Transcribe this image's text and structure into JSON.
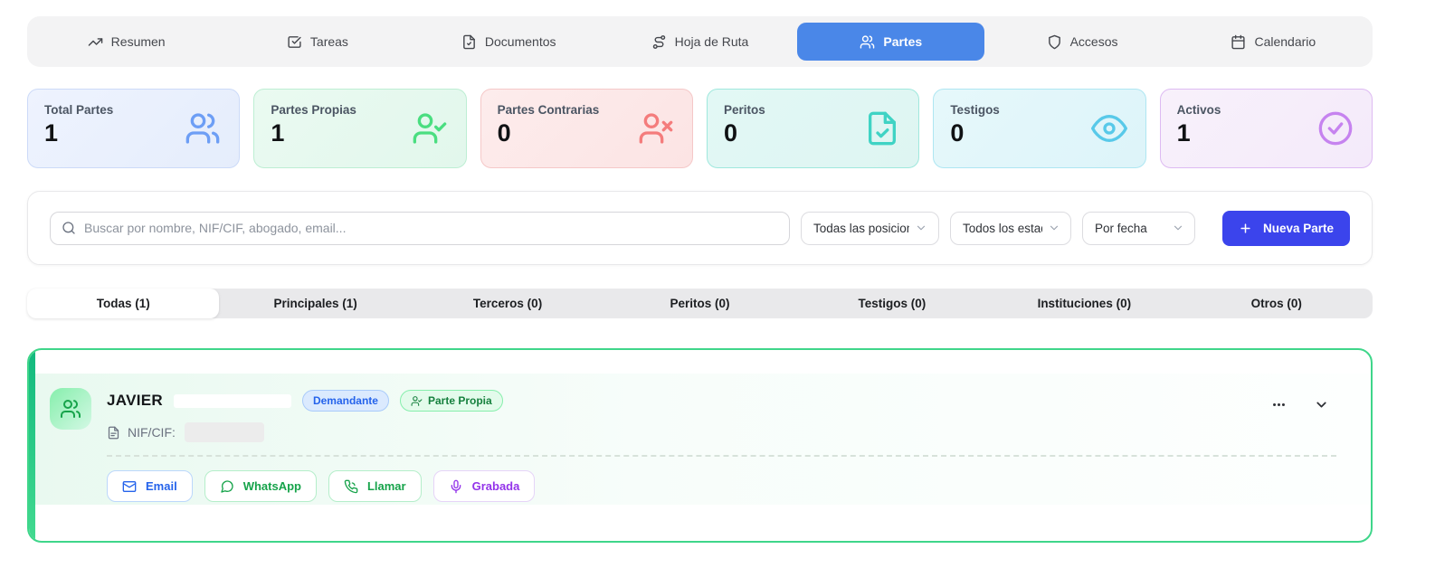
{
  "nav_tabs": {
    "active_color": "#4a87e8",
    "items": [
      {
        "label": "Resumen",
        "icon": "trending-up-icon",
        "active": false
      },
      {
        "label": "Tareas",
        "icon": "check-square-icon",
        "active": false
      },
      {
        "label": "Documentos",
        "icon": "file-text-icon",
        "active": false
      },
      {
        "label": "Hoja de Ruta",
        "icon": "route-icon",
        "active": false
      },
      {
        "label": "Partes",
        "icon": "users-icon",
        "active": true
      },
      {
        "label": "Accesos",
        "icon": "shield-icon",
        "active": false
      },
      {
        "label": "Calendario",
        "icon": "calendar-icon",
        "active": false
      }
    ]
  },
  "stats": {
    "cards": [
      {
        "label": "Total Partes",
        "value": "1",
        "icon": "users-icon",
        "accent": "#6d9ef5"
      },
      {
        "label": "Partes Propias",
        "value": "1",
        "icon": "user-check-icon",
        "accent": "#4ade80"
      },
      {
        "label": "Partes Contrarias",
        "value": "0",
        "icon": "user-x-icon",
        "accent": "#f47c7c"
      },
      {
        "label": "Peritos",
        "value": "0",
        "icon": "file-check-icon",
        "accent": "#3fd3c4"
      },
      {
        "label": "Testigos",
        "value": "0",
        "icon": "eye-icon",
        "accent": "#58c9e9"
      },
      {
        "label": "Activos",
        "value": "1",
        "icon": "check-circle-icon",
        "accent": "#c683ef"
      }
    ]
  },
  "toolbar": {
    "search_placeholder": "Buscar por nombre, NIF/CIF, abogado, email...",
    "position_filter": "Todas las posiciones",
    "status_filter": "Todos los estados",
    "date_filter": "Por fecha",
    "new_button_label": "Nueva Parte",
    "new_button_color": "#3b44ec"
  },
  "filter_tabs": {
    "items": [
      {
        "label": "Todas (1)",
        "active": true
      },
      {
        "label": "Principales (1)",
        "active": false
      },
      {
        "label": "Terceros (0)",
        "active": false
      },
      {
        "label": "Peritos (0)",
        "active": false
      },
      {
        "label": "Testigos (0)",
        "active": false
      },
      {
        "label": "Instituciones (0)",
        "active": false
      },
      {
        "label": "Otros (0)",
        "active": false
      }
    ]
  },
  "party_card": {
    "accent_color": "#3fd68a",
    "name": "JAVIER",
    "position_badge": "Demandante",
    "ownership_badge": "Parte Propia",
    "nif_label": "NIF/CIF:",
    "actions": [
      {
        "label": "Email",
        "icon": "mail-icon",
        "color": "#2563eb"
      },
      {
        "label": "WhatsApp",
        "icon": "message-circle-icon",
        "color": "#16a34a"
      },
      {
        "label": "Llamar",
        "icon": "phone-call-icon",
        "color": "#16a34a"
      },
      {
        "label": "Grabada",
        "icon": "mic-icon",
        "color": "#9333ea"
      }
    ]
  }
}
